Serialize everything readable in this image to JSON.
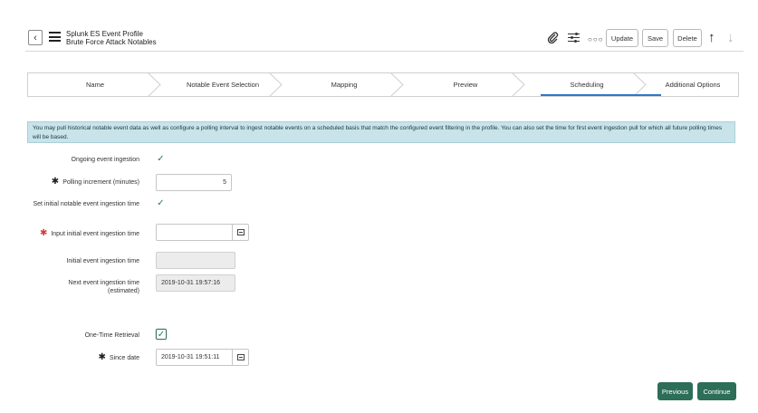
{
  "header": {
    "title": "Splunk ES Event Profile",
    "subtitle": "Brute Force Attack Notables",
    "back_icon": "chevron-left-icon",
    "menu_icon": "hamburger-menu-icon",
    "buttons": {
      "update": "Update",
      "save": "Save",
      "delete": "Delete"
    }
  },
  "wizard": {
    "steps": [
      "Name",
      "Notable Event Selection",
      "Mapping",
      "Preview",
      "Scheduling",
      "Additional Options"
    ],
    "active_step": "Scheduling"
  },
  "info": {
    "text": "You may pull historical notable event data as well as configure a polling interval to ingest notable events on a scheduled basis that match the configured event filtering in the profile. You can also set the time for first event ingestion pull for which all future polling times will be based."
  },
  "form": {
    "ongoing_label": "Ongoing event ingestion",
    "ongoing_checked": true,
    "polling_label": "Polling increment (minutes)",
    "polling_value": "5",
    "set_initial_label": "Set initial notable event ingestion time",
    "set_initial_checked": true,
    "input_initial_label": "Input initial event ingestion time",
    "input_initial_value": "",
    "initial_time_label": "Initial event ingestion time",
    "initial_time_value": "",
    "next_time_label": "Next event ingestion time (estimated)",
    "next_time_value": "2019-10-31 19:57:16",
    "one_time_label": "One-Time Retrieval",
    "one_time_checked": true,
    "since_label": "Since date",
    "since_value": "2019-10-31 19:51:11"
  },
  "footer": {
    "previous": "Previous",
    "continue": "Continue"
  },
  "colors": {
    "primary_button": "#2d6e59",
    "active_step": "#2e77c9",
    "info_bg": "#c9e3ea",
    "required_mark": "#d43c3c"
  }
}
